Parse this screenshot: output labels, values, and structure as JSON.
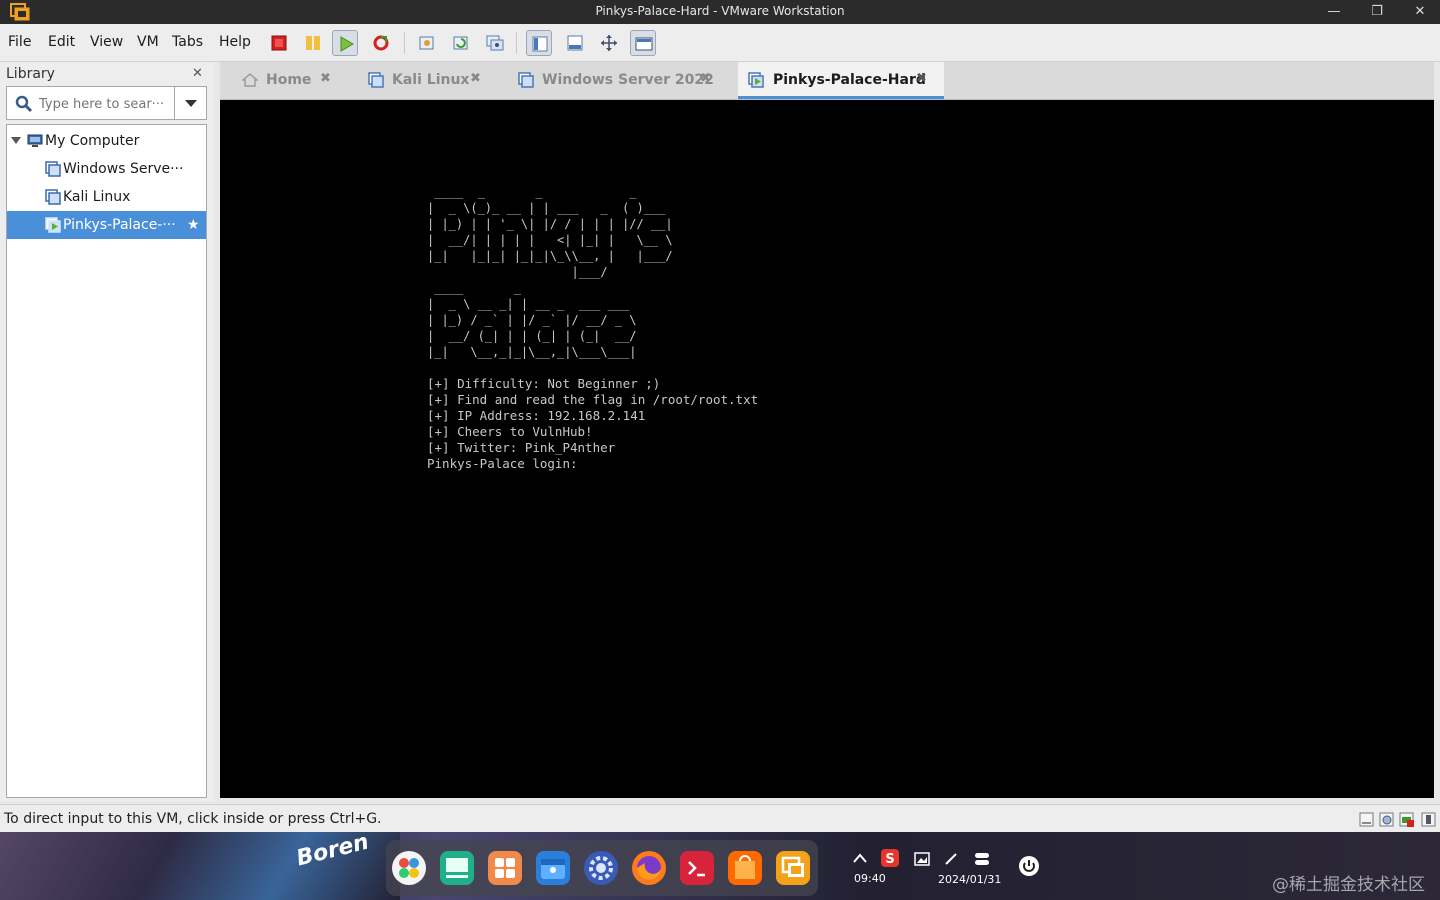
{
  "window": {
    "title": "Pinkys-Palace-Hard - VMware Workstation",
    "controls": [
      "—",
      "❐",
      "✕"
    ]
  },
  "menu": {
    "items": [
      "File",
      "Edit",
      "View",
      "VM",
      "Tabs",
      "Help"
    ]
  },
  "library": {
    "header": "Library",
    "search_placeholder": "Type here to sear···",
    "tree": [
      {
        "label": "My Computer"
      },
      {
        "label": "Windows Serve···"
      },
      {
        "label": "Kali Linux"
      },
      {
        "label": "Pinkys-Palace-···",
        "selected": true
      }
    ]
  },
  "tabs": [
    {
      "label": "Home",
      "active": false
    },
    {
      "label": "Kali Linux",
      "active": false
    },
    {
      "label": "Windows Server 2022",
      "active": false
    },
    {
      "label": "Pinkys-Palace-Hard",
      "active": true
    }
  ],
  "console": {
    "banner": " ____  _       _            _\n|  _ \\(_)_ __ | | ___   _  ( )___\n| |_) | | '_ \\| |/ / | | | |// __|\n|  __/| | | | |   <| |_| |   \\__ \\\n|_|   |_|_| |_|_|\\_\\\\__, |   |___/\n                    |___/\n ____       _\n|  _ \\ __ _| | __ _  ___ ___\n| |_) / _` | |/ _` |/ __/ _ \\\n|  __/ (_| | | (_| | (_|  __/\n|_|   \\__,_|_|\\__,_|\\___\\___|",
    "lines": "[+] Difficulty: Not Beginner ;)\n[+] Find and read the flag in /root/root.txt\n[+] IP Address: 192.168.2.141\n[+] Cheers to VulnHub!\n[+] Twitter: Pink_P4nther\nPinkys-Palace login: "
  },
  "status": {
    "text": "To direct input to this VM, click inside or press Ctrl+G."
  },
  "taskbar": {
    "desktop_text": "Boren",
    "time": "09:40",
    "date": "2024/01/31",
    "watermark": "@稀土掘金技术社区"
  },
  "colors": {
    "accent": "#4a90d9",
    "console_bg": "#000000",
    "console_fg": "#c8c8c8"
  }
}
